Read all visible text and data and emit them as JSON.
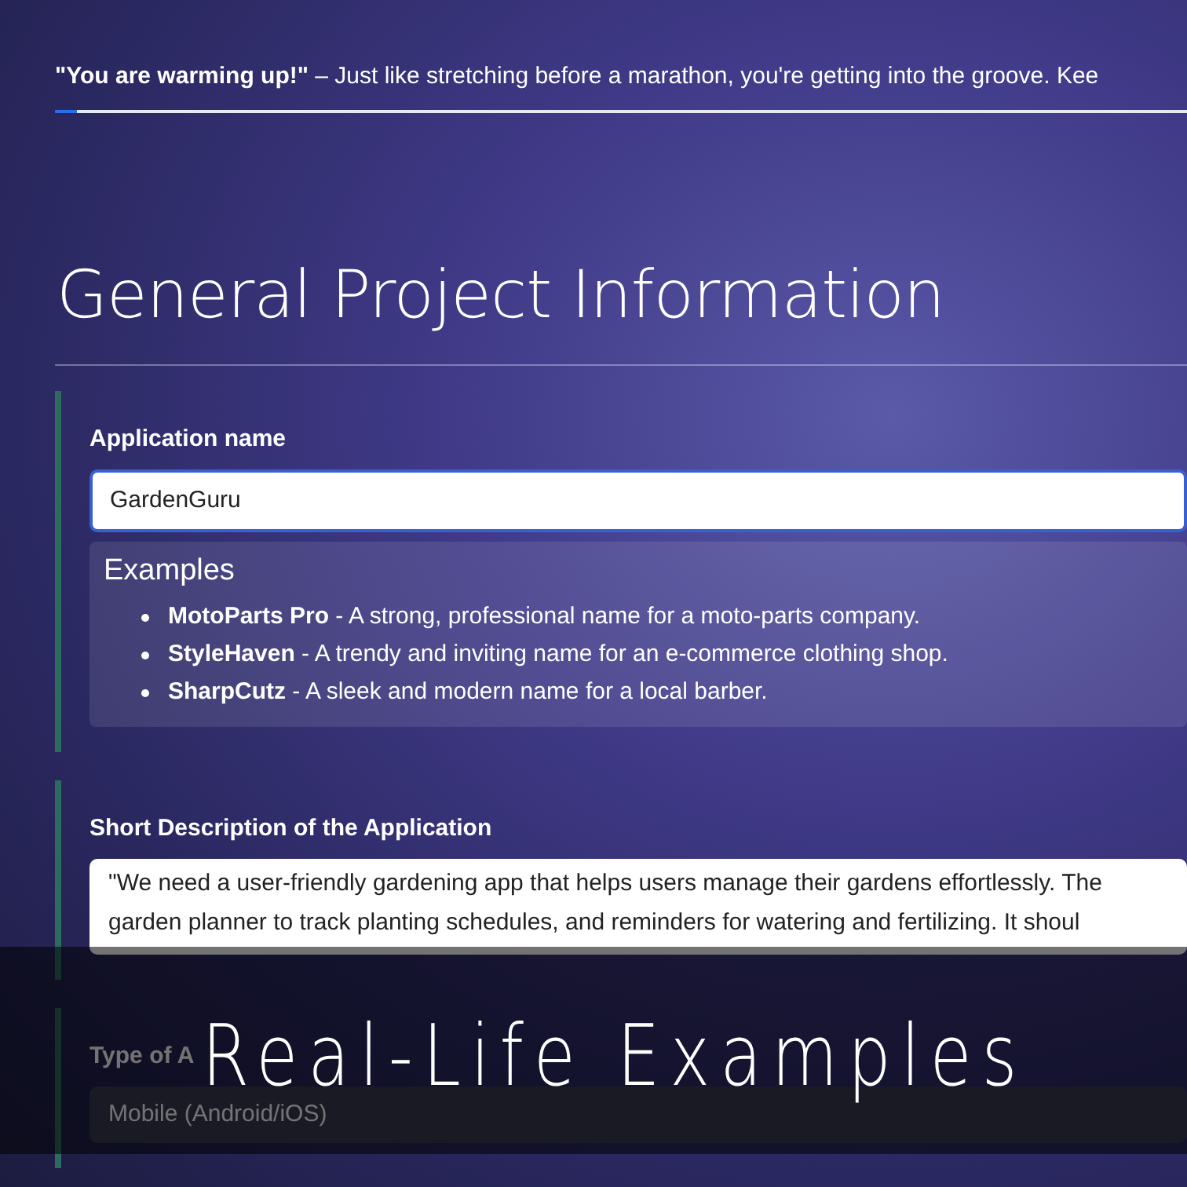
{
  "progress_message": "**\"You are warming up!\"** – Just like stretching before a marathon, you're getting into the groove. Kee",
  "progress": {
    "level": 0.02
  },
  "heading": "General Project Information",
  "sections": [
    {
      "kind": "input",
      "label": "Application name",
      "value": "GardenGuru",
      "focused": true,
      "examples": {
        "title": "Examples",
        "items": [
          "**MotoParts Pro** - A strong, professional name for a moto-parts company.",
          "**StyleHaven** - A trendy and inviting name for an e-commerce clothing shop.",
          "**SharpCutz** - A sleek and modern name for a local barber."
        ]
      }
    },
    {
      "kind": "textarea",
      "label": "Short Description of the Application",
      "lines": [
        "\"We need a user-friendly gardening app that helps users manage their gardens effortlessly. The",
        "garden planner to track planting schedules, and reminders for watering and fertilizing. It shoul"
      ]
    },
    {
      "kind": "select",
      "label": "Type of A",
      "value": "Mobile (Android/iOS)"
    }
  ],
  "banner": {
    "title": "Real-Life Examples"
  }
}
